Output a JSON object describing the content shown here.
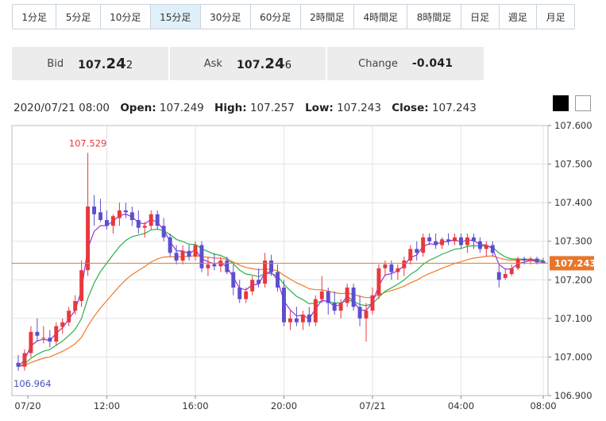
{
  "timeframes": [
    {
      "label": "1分足",
      "active": false
    },
    {
      "label": "5分足",
      "active": false
    },
    {
      "label": "10分足",
      "active": false
    },
    {
      "label": "15分足",
      "active": true
    },
    {
      "label": "30分足",
      "active": false
    },
    {
      "label": "60分足",
      "active": false
    },
    {
      "label": "2時間足",
      "active": false
    },
    {
      "label": "4時間足",
      "active": false
    },
    {
      "label": "8時間足",
      "active": false
    },
    {
      "label": "日足",
      "active": false
    },
    {
      "label": "週足",
      "active": false
    },
    {
      "label": "月足",
      "active": false
    }
  ],
  "quote": {
    "bid_label": "Bid",
    "bid_main": "107.",
    "bid_big": "24",
    "bid_small": "2",
    "ask_label": "Ask",
    "ask_main": "107.",
    "ask_big": "24",
    "ask_small": "6",
    "change_label": "Change",
    "change_value": "-0.041"
  },
  "ohlc": {
    "datetime": "2020/07/21 08:00",
    "open_label": "Open:",
    "open": "107.249",
    "high_label": "High:",
    "high": "107.257",
    "low_label": "Low:",
    "low": "107.243",
    "close_label": "Close:",
    "close": "107.243"
  },
  "chart_data": {
    "type": "candlestick",
    "ylim": [
      106.9,
      107.6
    ],
    "y_ticks": [
      "107.600",
      "107.500",
      "107.400",
      "107.300",
      "107.200",
      "107.100",
      "107.000",
      "106.900"
    ],
    "x_ticks": [
      "07/20",
      "12:00",
      "16:00",
      "20:00",
      "07/21",
      "04:00",
      "08:00"
    ],
    "current_price": "107.243",
    "max_label": "107.529",
    "min_label": "106.964",
    "colors": {
      "up": "#e8383d",
      "down": "#5b4fcf",
      "ma_short": "#9b30d9",
      "ma_mid": "#27b14b",
      "ma_long": "#f07a28",
      "current": "#e8762a"
    },
    "candles": [
      [
        106.985,
        107.005,
        106.964,
        106.975
      ],
      [
        106.975,
        107.02,
        106.965,
        107.01
      ],
      [
        107.01,
        107.08,
        107.0,
        107.065
      ],
      [
        107.065,
        107.1,
        107.04,
        107.055
      ],
      [
        107.05,
        107.08,
        107.035,
        107.05
      ],
      [
        107.05,
        107.07,
        107.025,
        107.04
      ],
      [
        107.04,
        107.09,
        107.03,
        107.08
      ],
      [
        107.078,
        107.1,
        107.06,
        107.09
      ],
      [
        107.09,
        107.13,
        107.08,
        107.12
      ],
      [
        107.12,
        107.16,
        107.11,
        107.145
      ],
      [
        107.145,
        107.25,
        107.13,
        107.225
      ],
      [
        107.225,
        107.529,
        107.21,
        107.39
      ],
      [
        107.39,
        107.42,
        107.34,
        107.37
      ],
      [
        107.375,
        107.41,
        107.35,
        107.355
      ],
      [
        107.355,
        107.38,
        107.33,
        107.34
      ],
      [
        107.34,
        107.37,
        107.32,
        107.365
      ],
      [
        107.36,
        107.4,
        107.34,
        107.38
      ],
      [
        107.38,
        107.4,
        107.36,
        107.375
      ],
      [
        107.375,
        107.39,
        107.34,
        107.355
      ],
      [
        107.355,
        107.38,
        107.32,
        107.335
      ],
      [
        107.335,
        107.35,
        107.31,
        107.34
      ],
      [
        107.34,
        107.38,
        107.33,
        107.37
      ],
      [
        107.37,
        107.38,
        107.33,
        107.34
      ],
      [
        107.34,
        107.36,
        107.3,
        107.31
      ],
      [
        107.31,
        107.32,
        107.26,
        107.27
      ],
      [
        107.27,
        107.29,
        107.24,
        107.25
      ],
      [
        107.25,
        107.29,
        107.24,
        107.275
      ],
      [
        107.275,
        107.29,
        107.25,
        107.26
      ],
      [
        107.26,
        107.3,
        107.25,
        107.29
      ],
      [
        107.29,
        107.3,
        107.22,
        107.23
      ],
      [
        107.23,
        107.26,
        107.21,
        107.24
      ],
      [
        107.24,
        107.27,
        107.225,
        107.235
      ],
      [
        107.235,
        107.26,
        107.22,
        107.25
      ],
      [
        107.25,
        107.26,
        107.215,
        107.22
      ],
      [
        107.22,
        107.24,
        107.16,
        107.18
      ],
      [
        107.18,
        107.2,
        107.14,
        107.15
      ],
      [
        107.15,
        107.18,
        107.14,
        107.17
      ],
      [
        107.17,
        107.21,
        107.16,
        107.2
      ],
      [
        107.2,
        107.23,
        107.18,
        107.19
      ],
      [
        107.19,
        107.27,
        107.18,
        107.25
      ],
      [
        107.25,
        107.265,
        107.21,
        107.22
      ],
      [
        107.22,
        107.24,
        107.17,
        107.18
      ],
      [
        107.18,
        107.2,
        107.08,
        107.09
      ],
      [
        107.09,
        107.12,
        107.07,
        107.1
      ],
      [
        107.1,
        107.13,
        107.08,
        107.09
      ],
      [
        107.09,
        107.12,
        107.07,
        107.11
      ],
      [
        107.11,
        107.13,
        107.08,
        107.09
      ],
      [
        107.09,
        107.16,
        107.08,
        107.15
      ],
      [
        107.15,
        107.21,
        107.14,
        107.17
      ],
      [
        107.17,
        107.18,
        107.11,
        107.14
      ],
      [
        107.14,
        107.17,
        107.11,
        107.12
      ],
      [
        107.12,
        107.15,
        107.1,
        107.14
      ],
      [
        107.14,
        107.19,
        107.13,
        107.18
      ],
      [
        107.18,
        107.19,
        107.12,
        107.13
      ],
      [
        107.13,
        107.16,
        107.08,
        107.1
      ],
      [
        107.1,
        107.14,
        107.04,
        107.12
      ],
      [
        107.12,
        107.18,
        107.11,
        107.16
      ],
      [
        107.16,
        107.24,
        107.15,
        107.23
      ],
      [
        107.23,
        107.25,
        107.21,
        107.24
      ],
      [
        107.24,
        107.25,
        107.2,
        107.22
      ],
      [
        107.22,
        107.24,
        107.2,
        107.23
      ],
      [
        107.23,
        107.26,
        107.21,
        107.25
      ],
      [
        107.25,
        107.29,
        107.24,
        107.28
      ],
      [
        107.28,
        107.3,
        107.25,
        107.27
      ],
      [
        107.27,
        107.32,
        107.26,
        107.31
      ],
      [
        107.31,
        107.32,
        107.29,
        107.3
      ],
      [
        107.3,
        107.32,
        107.28,
        107.29
      ],
      [
        107.29,
        107.31,
        107.28,
        107.305
      ],
      [
        107.305,
        107.32,
        107.29,
        107.3
      ],
      [
        107.3,
        107.32,
        107.29,
        107.31
      ],
      [
        107.31,
        107.32,
        107.28,
        107.29
      ],
      [
        107.29,
        107.32,
        107.27,
        107.31
      ],
      [
        107.31,
        107.32,
        107.28,
        107.3
      ],
      [
        107.3,
        107.31,
        107.27,
        107.28
      ],
      [
        107.28,
        107.3,
        107.26,
        107.29
      ],
      [
        107.29,
        107.3,
        107.26,
        107.27
      ],
      [
        107.22,
        107.24,
        107.18,
        107.2
      ],
      [
        107.205,
        107.23,
        107.2,
        107.215
      ],
      [
        107.215,
        107.24,
        107.21,
        107.23
      ],
      [
        107.23,
        107.26,
        107.225,
        107.255
      ],
      [
        107.255,
        107.26,
        107.24,
        107.25
      ],
      [
        107.25,
        107.26,
        107.24,
        107.255
      ],
      [
        107.255,
        107.26,
        107.24,
        107.245
      ],
      [
        107.249,
        107.257,
        107.243,
        107.243
      ]
    ]
  }
}
